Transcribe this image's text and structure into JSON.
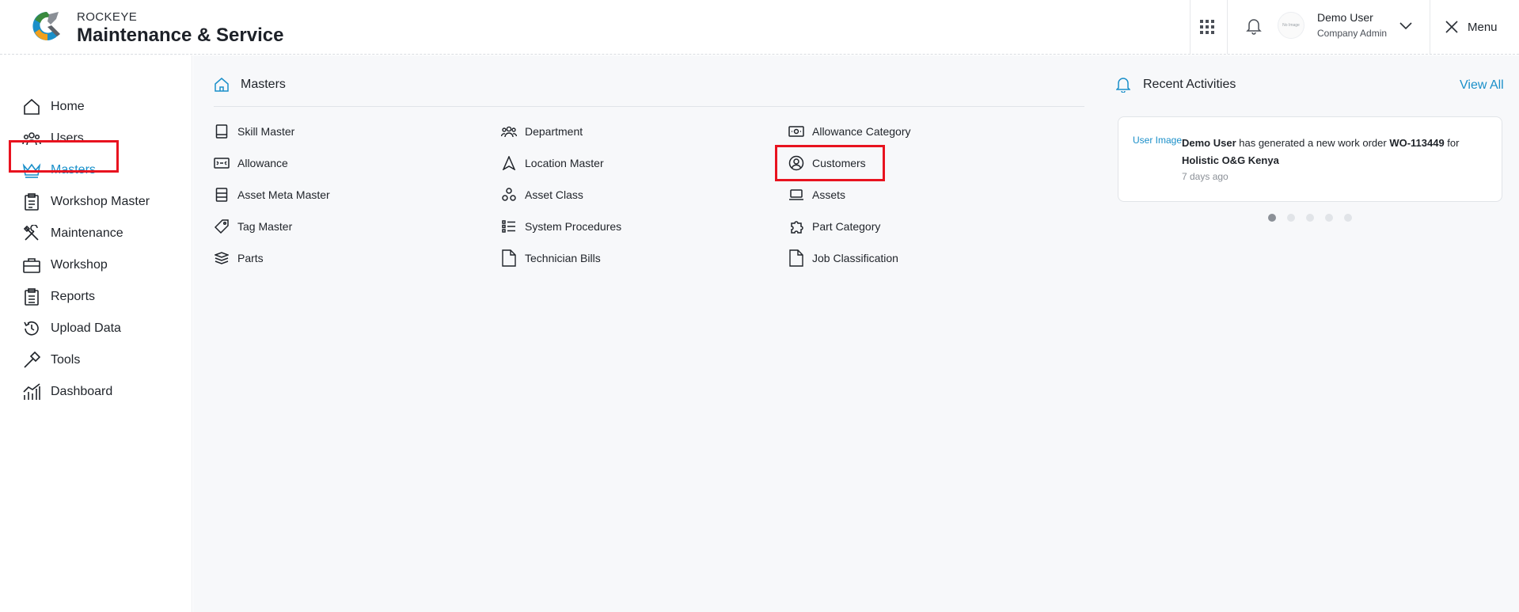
{
  "header": {
    "brand_small": "ROCKEYE",
    "brand_big": "Maintenance & Service",
    "avatar_text": "No Image",
    "user_name": "Demo User",
    "user_role": "Company Admin",
    "menu_label": "Menu"
  },
  "sidebar": {
    "items": [
      {
        "label": "Home",
        "icon": "home-icon"
      },
      {
        "label": "Users",
        "icon": "users-icon"
      },
      {
        "label": "Masters",
        "icon": "crown-icon",
        "active": true
      },
      {
        "label": "Workshop Master",
        "icon": "clipboard-icon"
      },
      {
        "label": "Maintenance",
        "icon": "tools-icon"
      },
      {
        "label": "Workshop",
        "icon": "briefcase-icon"
      },
      {
        "label": "Reports",
        "icon": "report-icon"
      },
      {
        "label": "Upload Data",
        "icon": "history-icon"
      },
      {
        "label": "Tools",
        "icon": "hammer-icon"
      },
      {
        "label": "Dashboard",
        "icon": "chart-icon"
      }
    ]
  },
  "main": {
    "title": "Masters",
    "items": [
      {
        "label": "Skill Master",
        "icon": "book-icon"
      },
      {
        "label": "Department",
        "icon": "group-icon"
      },
      {
        "label": "Allowance Category",
        "icon": "money-icon"
      },
      {
        "label": "Allowance",
        "icon": "allowance-icon"
      },
      {
        "label": "Location Master",
        "icon": "navigation-icon"
      },
      {
        "label": "Customers",
        "icon": "user-circle-icon"
      },
      {
        "label": "Asset Meta Master",
        "icon": "list-box-icon"
      },
      {
        "label": "Asset Class",
        "icon": "nodes-icon"
      },
      {
        "label": "Assets",
        "icon": "laptop-icon"
      },
      {
        "label": "Tag Master",
        "icon": "tag-icon"
      },
      {
        "label": "System Procedures",
        "icon": "checklist-icon"
      },
      {
        "label": "Part Category",
        "icon": "puzzle-icon"
      },
      {
        "label": "Parts",
        "icon": "layers-icon"
      },
      {
        "label": "Technician Bills",
        "icon": "file-icon"
      },
      {
        "label": "Job Classification",
        "icon": "file-icon"
      }
    ]
  },
  "activities": {
    "title": "Recent Activities",
    "view_all": "View All",
    "image_alt": "User Image",
    "user": "Demo User",
    "text": " has generated a new work order ",
    "work_order": "WO-113449",
    "for_text": " for",
    "company": "Holistic O&G Kenya",
    "time": "7 days ago",
    "dots_count": 5,
    "active_dot": 1
  },
  "colors": {
    "accent": "#1a8fc9",
    "highlight": "#e8131f"
  }
}
